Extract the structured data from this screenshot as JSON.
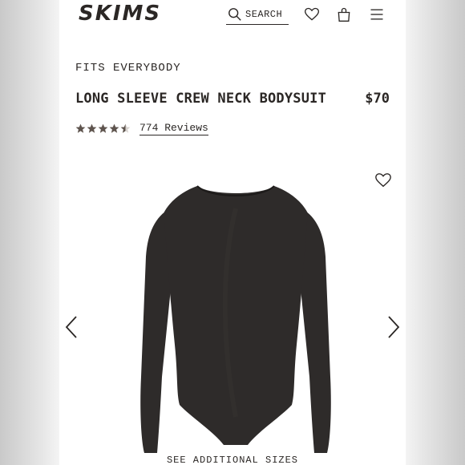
{
  "header": {
    "logo": "SKIMS",
    "search_label": "SEARCH",
    "icons": [
      "search-icon",
      "heart-icon",
      "bag-icon",
      "menu-icon"
    ]
  },
  "product": {
    "tagline": "FITS EVERYBODY",
    "title": "LONG SLEEVE CREW NECK BODYSUIT",
    "price": "$70",
    "rating": 4.5,
    "reviews_label": "774 Reviews",
    "see_sizes": "SEE ADDITIONAL SIZES"
  },
  "colors": {
    "text": "#2b2725",
    "star": "#5e544e",
    "garment": "#2e2b2a"
  }
}
